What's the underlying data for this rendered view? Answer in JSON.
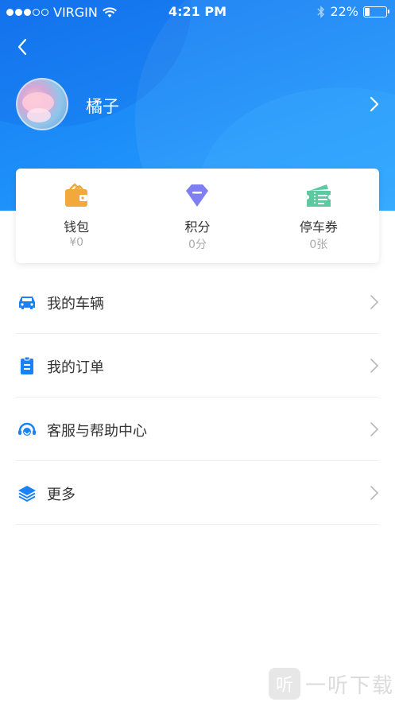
{
  "status_bar": {
    "carrier": "VIRGIN",
    "time": "4:21 PM",
    "battery": "22%",
    "battery_level": 0.22,
    "signal_bars_filled": 3,
    "signal_bars_total": 5
  },
  "header": {
    "username": "橘子",
    "gradient_colors": [
      "#1677f0",
      "#29a3ff"
    ]
  },
  "assets": [
    {
      "name": "wallet",
      "label": "钱包",
      "value": "¥0",
      "icon": "wallet-icon",
      "color": "#f0a93a"
    },
    {
      "name": "points",
      "label": "积分",
      "value": "0分",
      "icon": "diamond-icon",
      "color": "#7f7ff0"
    },
    {
      "name": "coupons",
      "label": "停车券",
      "value": "0张",
      "icon": "ticket-icon",
      "color": "#5cc9a0"
    }
  ],
  "menu": [
    {
      "label": "我的车辆",
      "icon": "car-icon"
    },
    {
      "label": "我的订单",
      "icon": "clipboard-icon"
    },
    {
      "label": "客服与帮助中心",
      "icon": "headset-icon"
    },
    {
      "label": "更多",
      "icon": "layers-icon"
    }
  ],
  "watermark": {
    "logo_text": "听",
    "text": "一听下载"
  },
  "colors": {
    "accent": "#1a82f5",
    "text": "#333333",
    "muted": "#aaaaaa"
  }
}
